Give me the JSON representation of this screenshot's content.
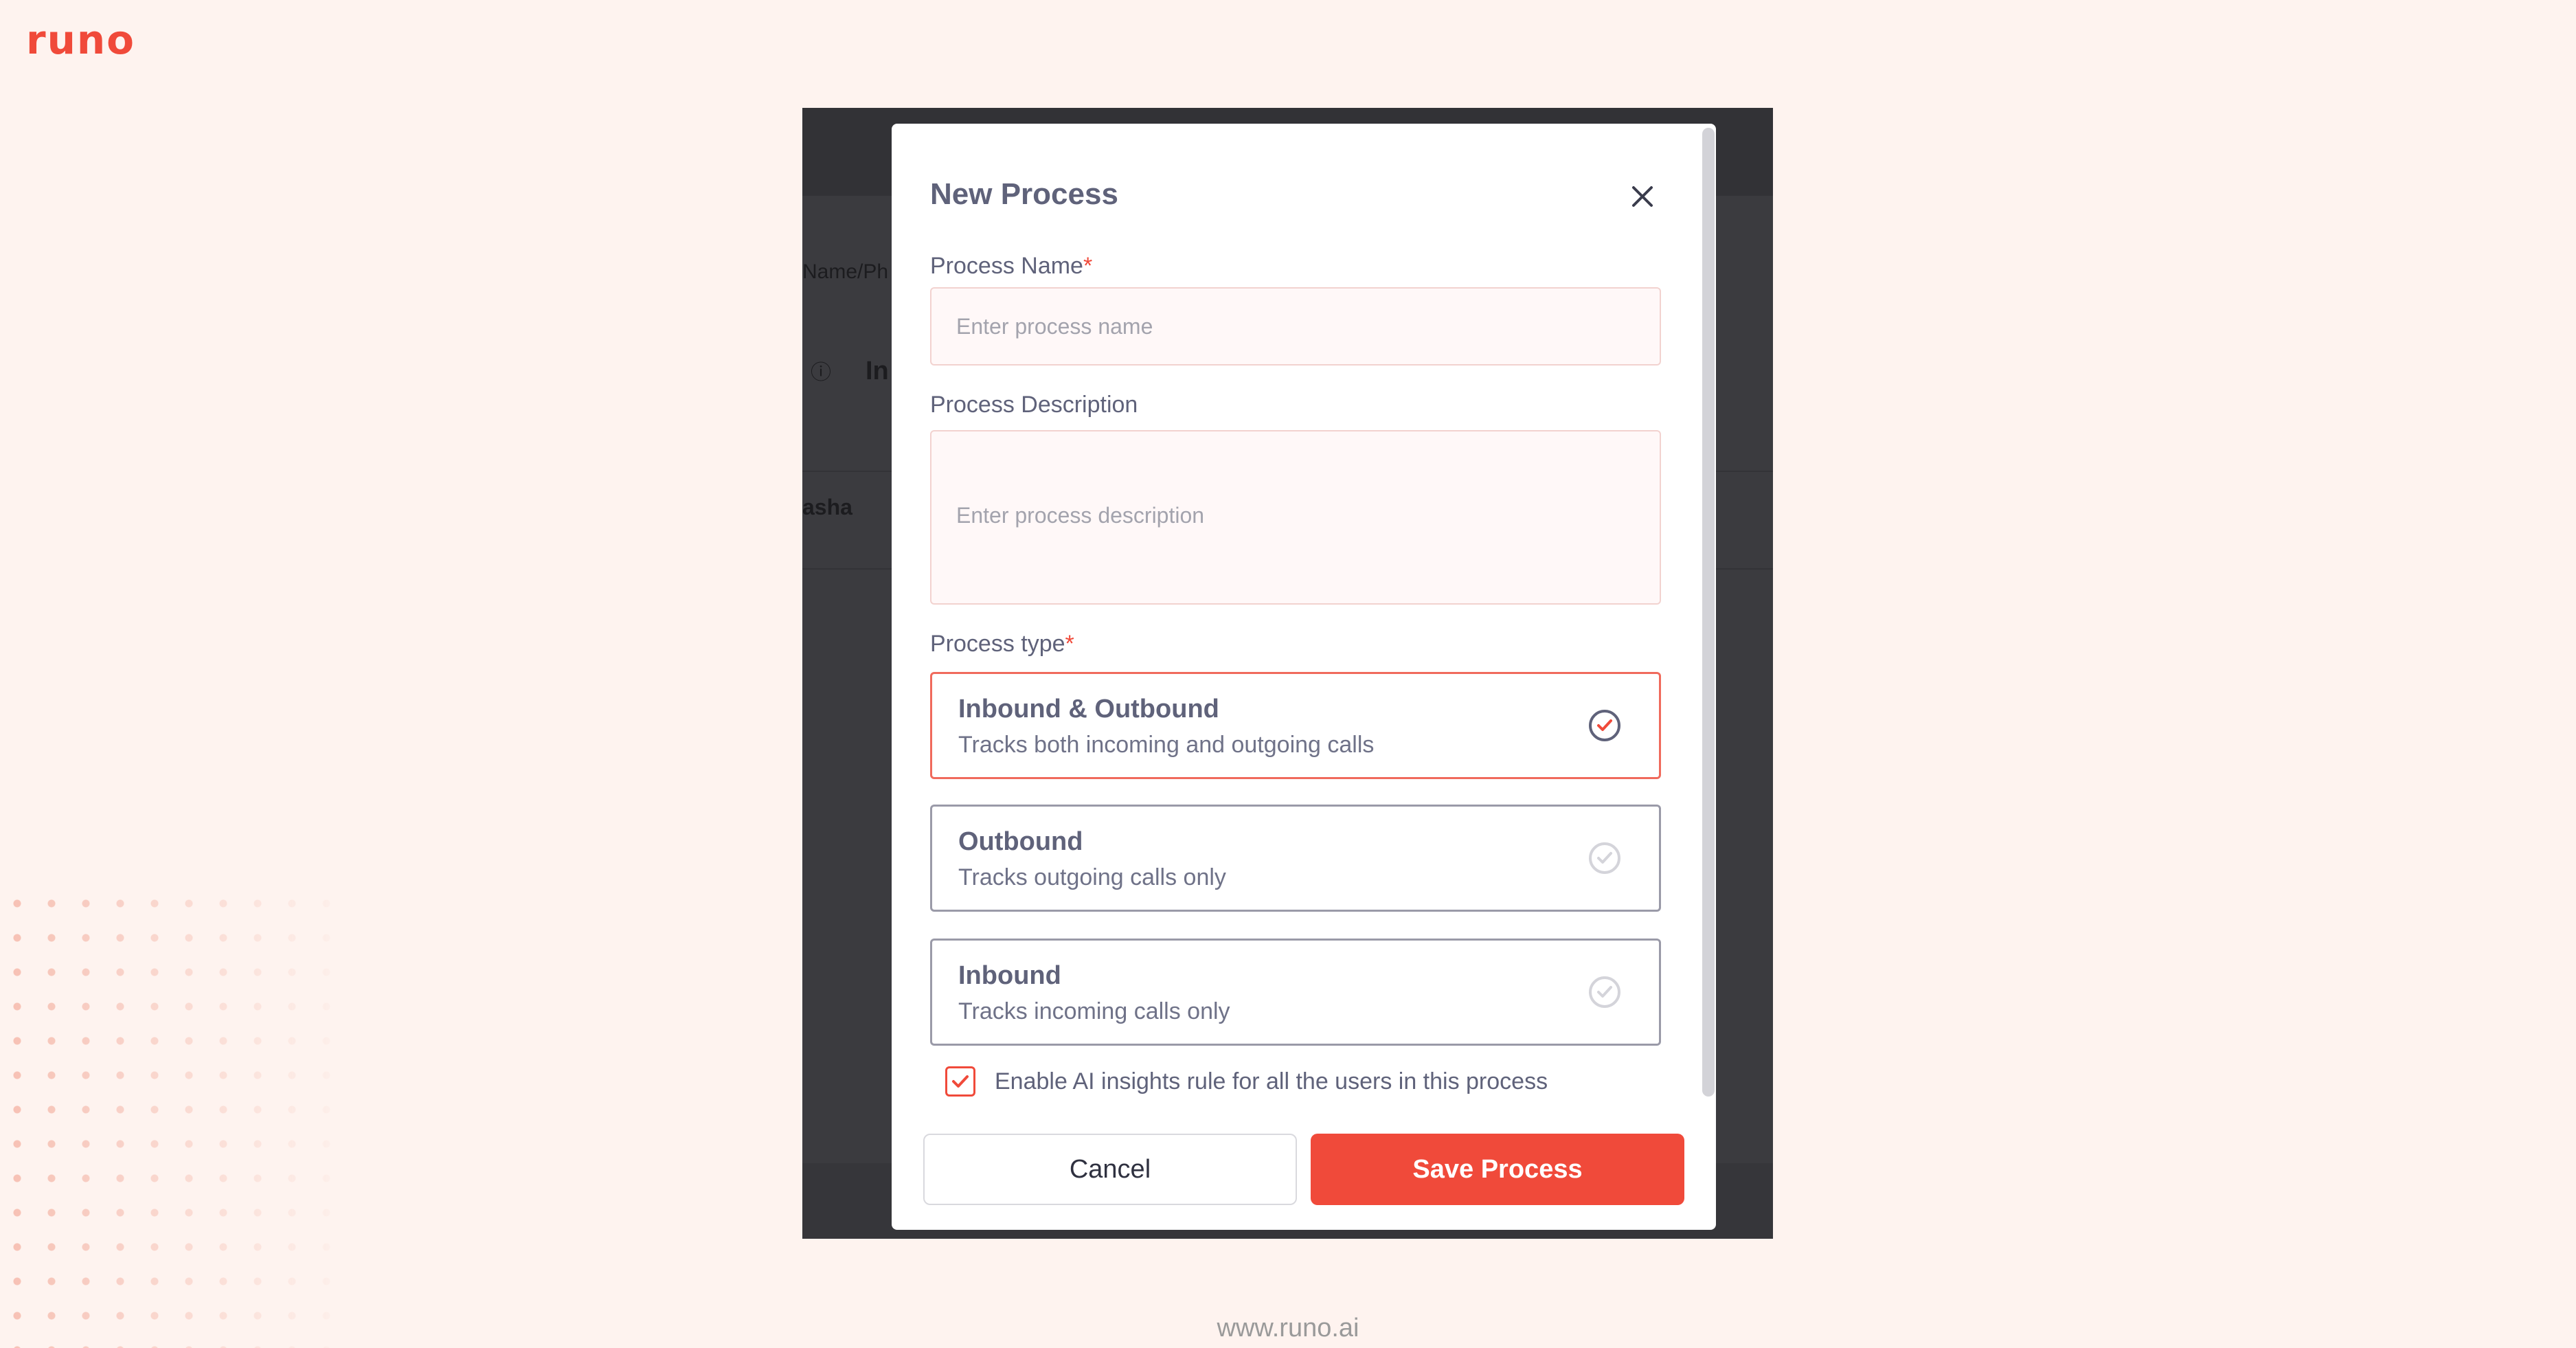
{
  "brand": {
    "logo_text": "runo",
    "footer_url": "www.runo.ai"
  },
  "background_app": {
    "search_fragment": "Name/Ph",
    "heading_fragment": "In",
    "row_fragment": "asha"
  },
  "modal": {
    "title": "New Process",
    "process_name": {
      "label": "Process Name",
      "required_mark": "*",
      "placeholder": "Enter process name",
      "value": ""
    },
    "process_description": {
      "label": "Process Description",
      "placeholder": "Enter process description",
      "value": ""
    },
    "process_type": {
      "label": "Process type",
      "required_mark": "*",
      "selected": "Inbound & Outbound",
      "options": [
        {
          "title": "Inbound & Outbound",
          "description": "Tracks both incoming and outgoing calls",
          "selected": true
        },
        {
          "title": "Outbound",
          "description": "Tracks outgoing calls only",
          "selected": false
        },
        {
          "title": "Inbound",
          "description": "Tracks incoming calls only",
          "selected": false
        }
      ]
    },
    "ai_insights": {
      "label": "Enable AI insights rule for all the users in this process",
      "checked": true
    },
    "cancel_label": "Cancel",
    "save_label": "Save Process"
  },
  "colors": {
    "accent": "#f04a3a",
    "text": "#5f627a",
    "page_bg": "#fef3ef",
    "overlay": "#3b3b3f"
  },
  "icons": {
    "close": "close-icon",
    "option_check": "check-circle-icon",
    "checkbox": "checkmark-icon"
  }
}
